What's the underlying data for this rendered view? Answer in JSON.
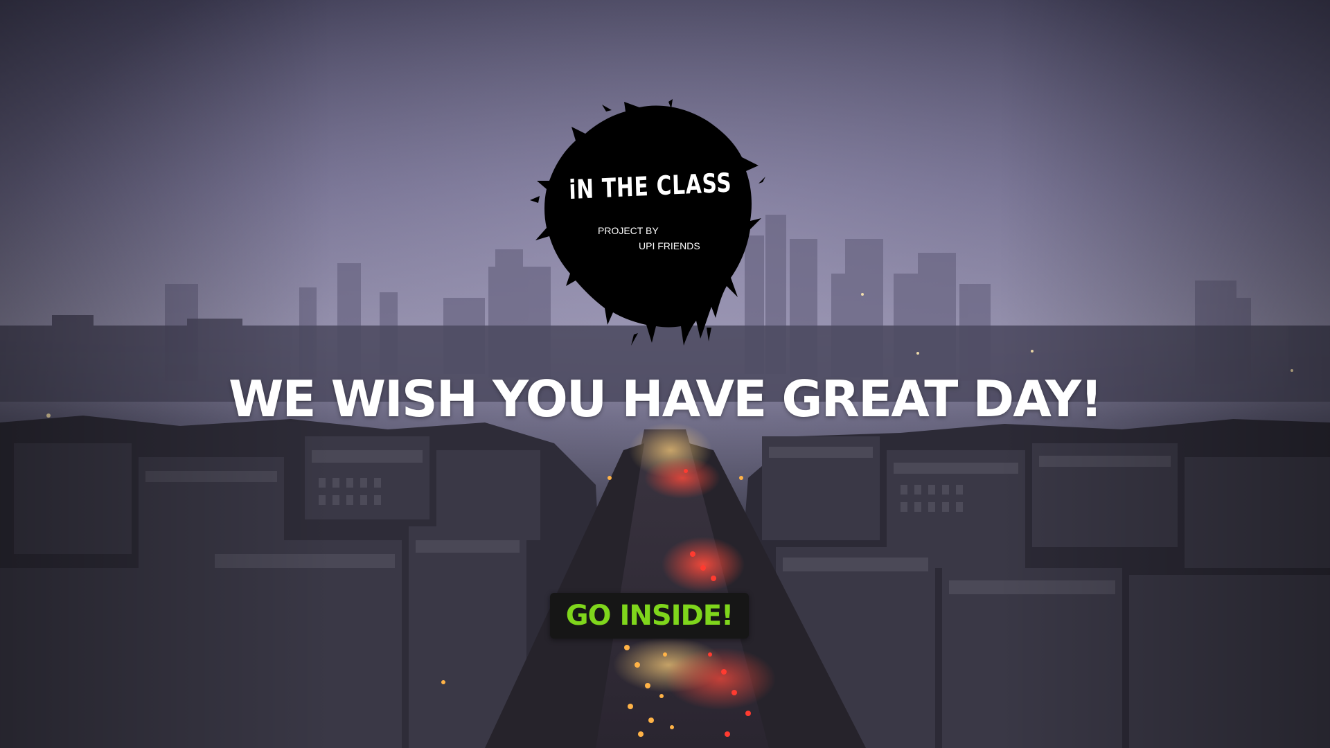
{
  "logo": {
    "title": "iN THE CLASS",
    "project_by": "PROJECT BY",
    "author": "UPI FRIENDS"
  },
  "hero": {
    "headline": "WE WISH YOU HAVE GREAT DAY!",
    "cta_label": "GO INSIDE!"
  },
  "colors": {
    "headline": "#ffffff",
    "cta_background": "#161616",
    "cta_text": "#7fd61c",
    "logo_blot": "#000000",
    "sky": "#8f8ba6"
  },
  "background": {
    "description_icon": "city-skyline-dusk-image"
  }
}
